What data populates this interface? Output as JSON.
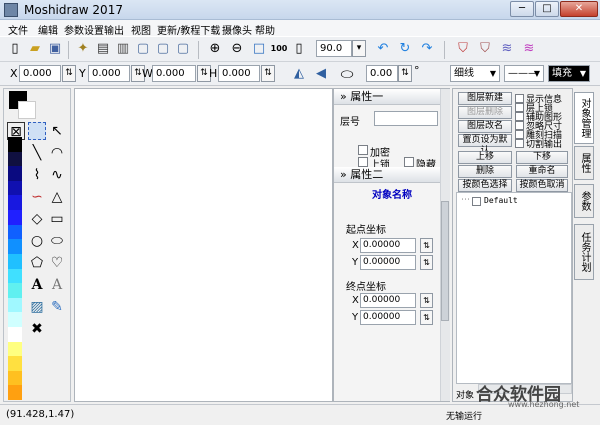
{
  "window": {
    "title": "Moshidraw 2017",
    "min": "─",
    "max": "□",
    "close": "✕"
  },
  "menubar": [
    "文件",
    "编辑",
    "参数设置",
    "输出",
    "视图",
    "更新/教程下载",
    "摄像头",
    "帮助"
  ],
  "toolbar1": {
    "zoom_value": "90.0",
    "icons": [
      "new-file-icon",
      "open-folder-icon",
      "save-icon",
      "magic-wand-icon",
      "film-icon",
      "printer-icon",
      "paste-icon",
      "copy-icon",
      "zoom-in-icon",
      "zoom-out-icon",
      "fit-page-icon",
      "zoom-100-icon",
      "blank-page-icon",
      "undo-icon",
      "rotate-icon",
      "redo-icon",
      "shield-icon",
      "shield-outline-icon",
      "wave-icon",
      "wave-cross-icon"
    ],
    "zoom100": "100"
  },
  "toolbar2": {
    "x_label": "X",
    "x_value": "0.000",
    "y_label": "Y",
    "y_value": "0.000",
    "w_label": "W",
    "w_value": "0.000",
    "h_label": "H",
    "h_value": "0.000",
    "angle_value": "0.00",
    "degree": "°",
    "line_style": "细线",
    "line_type": "———",
    "fill": "填充"
  },
  "prop_panel": {
    "section1_title": "属性一",
    "layer_label": "层号",
    "encrypt_label": "加密",
    "lock_label": "上锁",
    "hide_label": "隐藏",
    "section2_title": "属性二",
    "object_name": "对象名称",
    "start_label": "起点坐标",
    "start_x_label": "X",
    "start_x": "0.00000",
    "start_y_label": "Y",
    "start_y": "0.00000",
    "end_label": "终点坐标",
    "end_x_label": "X",
    "end_x": "0.00000",
    "end_y_label": "Y",
    "end_y": "0.00000"
  },
  "right_panel": {
    "new_layer": "图层新建",
    "delete_layer": "图层删除",
    "rename_layer": "图层改名",
    "set_default": "置页设为默认",
    "show_info": "显示信息",
    "layer_lock": "层上锁",
    "aux_graph": "辅助图形",
    "ignore_size": "忽略尺寸",
    "engrave_scan": "雕刻扫描",
    "cut_output": "切割输出",
    "move_up": "上移",
    "move_down": "下移",
    "delete": "删除",
    "rename": "重命名",
    "select_by_color": "按颜色选择",
    "cancel_by_color": "按颜色取消",
    "layer_default": "Default",
    "object_label": "对象"
  },
  "tabs": [
    "对象管理",
    "属性",
    "参数",
    "任务计划"
  ],
  "status": {
    "coords": "(91.428,1.47)",
    "message": "无输运行"
  },
  "watermark": {
    "text": "合众软件园",
    "url": "www.hezhong.net"
  },
  "colors": {
    "swatches": [
      "#000000",
      "#101040",
      "#0a0a80",
      "#1010b0",
      "#1818e0",
      "#2020ff",
      "#1060ff",
      "#1090ff",
      "#20c0ff",
      "#40e0ff",
      "#60f0f0",
      "#a0f8ff",
      "#d0ffff",
      "#ffffff",
      "#ffff80",
      "#ffe040",
      "#ffc020",
      "#ffa010"
    ]
  }
}
